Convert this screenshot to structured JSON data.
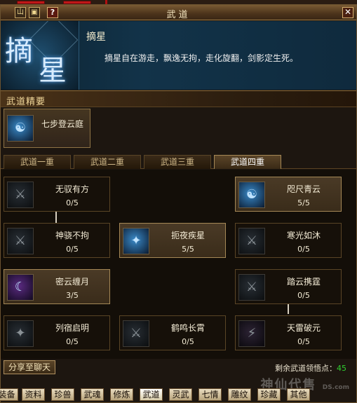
{
  "window": {
    "title": "武道"
  },
  "titlebar": {
    "help_label": "?",
    "close_label": "✕"
  },
  "skill": {
    "name": "摘星",
    "description": "摘星自在游走，飘逸无拘，走化旋翻，剑影定生死。",
    "emblem_chars": [
      "摘",
      "星"
    ]
  },
  "section": {
    "title": "武道精要"
  },
  "main_skill": {
    "name": "七步登云庭"
  },
  "tabs": [
    "武道一重",
    "武道二重",
    "武道三重",
    "武道四重"
  ],
  "selected_tab": 3,
  "skills": [
    {
      "name": "无驭有方",
      "level": "0/5"
    },
    {
      "name": "咫尺青云",
      "level": "5/5"
    },
    {
      "name": "神骁不拘",
      "level": "0/5"
    },
    {
      "name": "扼夜疾星",
      "level": "5/5"
    },
    {
      "name": "寒光如沐",
      "level": "0/5"
    },
    {
      "name": "密云缠月",
      "level": "3/5"
    },
    {
      "name": "踏云携霆",
      "level": "0/5"
    },
    {
      "name": "列宿启明",
      "level": "0/5"
    },
    {
      "name": "鹤鸣长霄",
      "level": "0/5"
    },
    {
      "name": "天雷破元",
      "level": "0/5"
    }
  ],
  "footer": {
    "share_label": "分享至聊天",
    "remaining_label": "剩余武道领悟点：",
    "remaining_value": "45"
  },
  "bottom_tabs": [
    "装备",
    "资料",
    "珍兽",
    "武魂",
    "修炼",
    "武道",
    "灵武",
    "七情",
    "雕纹",
    "珍藏",
    "其他"
  ],
  "selected_bottom_tab": 5,
  "watermark": {
    "text": "神仙代售",
    "url": "DS.com"
  },
  "colors": {
    "remaining_value": "#30d030",
    "title": "#f5e6c0"
  }
}
